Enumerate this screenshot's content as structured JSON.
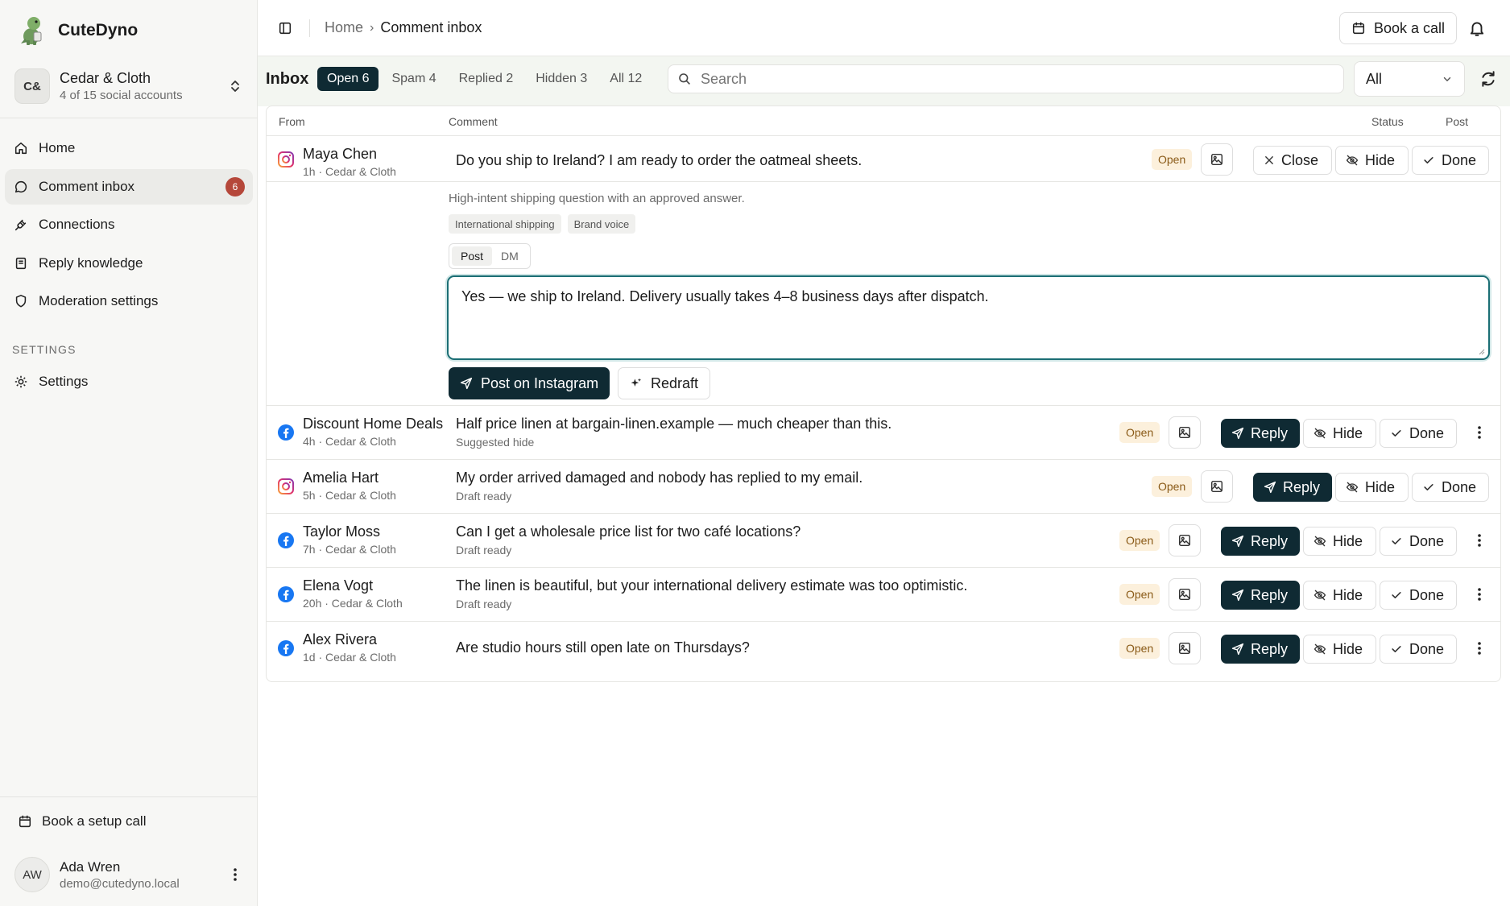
{
  "brand": {
    "name": "CuteDyno"
  },
  "account": {
    "initials": "C&",
    "name": "Cedar & Cloth",
    "sub": "4 of 15 social accounts"
  },
  "nav": [
    {
      "label": "Home"
    },
    {
      "label": "Comment inbox",
      "badge": "6"
    },
    {
      "label": "Connections"
    },
    {
      "label": "Reply knowledge"
    },
    {
      "label": "Moderation settings"
    }
  ],
  "settings_section": {
    "label": "SETTINGS",
    "item": "Settings"
  },
  "footer": {
    "setup_call": "Book a setup call",
    "user_initials": "AW",
    "user_name": "Ada Wren",
    "user_email": "demo@cutedyno.local"
  },
  "topbar": {
    "crumb_home": "Home",
    "crumb_current": "Comment inbox",
    "book_call": "Book a call"
  },
  "inbox": {
    "title": "Inbox",
    "tabs": [
      "Open 6",
      "Spam 4",
      "Replied 2",
      "Hidden 3",
      "All 12"
    ],
    "search_placeholder": "Search",
    "filter_value": "All"
  },
  "table": {
    "headers": {
      "from": "From",
      "comment": "Comment",
      "status": "Status",
      "post": "Post"
    },
    "expanded": {
      "name": "Maya Chen",
      "meta": "1h · Cedar & Cloth",
      "comment": "Do you ship to Ireland? I am ready to order the oatmeal sheets.",
      "status": "Open",
      "close": "Close",
      "hide": "Hide",
      "done": "Done",
      "reason": "High-intent shipping question with an approved answer.",
      "chips": [
        "International shipping",
        "Brand voice"
      ],
      "modes": [
        "Post",
        "DM"
      ],
      "draft": "Yes — we ship to Ireland. Delivery usually takes 4–8 business days after dispatch.",
      "post_button": "Post on Instagram",
      "redraft_button": "Redraft"
    },
    "rows": [
      {
        "platform": "facebook",
        "name": "Discount Home Deals",
        "meta": "4h · Cedar & Cloth",
        "comment": "Half price linen at bargain-linen.example — much cheaper than this.",
        "sub": "Suggested hide",
        "status": "Open",
        "reply": "Reply",
        "hide": "Hide",
        "done": "Done"
      },
      {
        "platform": "instagram",
        "name": "Amelia Hart",
        "meta": "5h · Cedar & Cloth",
        "comment": "My order arrived damaged and nobody has replied to my email.",
        "sub": "Draft ready",
        "status": "Open",
        "reply": "Reply",
        "hide": "Hide",
        "done": "Done"
      },
      {
        "platform": "facebook",
        "name": "Taylor Moss",
        "meta": "7h · Cedar & Cloth",
        "comment": "Can I get a wholesale price list for two café locations?",
        "sub": "Draft ready",
        "status": "Open",
        "reply": "Reply",
        "hide": "Hide",
        "done": "Done"
      },
      {
        "platform": "facebook",
        "name": "Elena Vogt",
        "meta": "20h · Cedar & Cloth",
        "comment": "The linen is beautiful, but your international delivery estimate was too optimistic.",
        "sub": "Draft ready",
        "status": "Open",
        "reply": "Reply",
        "hide": "Hide",
        "done": "Done"
      },
      {
        "platform": "facebook",
        "name": "Alex Rivera",
        "meta": "1d · Cedar & Cloth",
        "comment": "Are studio hours still open late on Thursdays?",
        "sub": "",
        "status": "Open",
        "reply": "Reply",
        "hide": "Hide",
        "done": "Done"
      }
    ]
  },
  "colors": {
    "primary": "#0f2a33",
    "badge_red": "#b5473a",
    "open_bg": "#fcf0dc",
    "open_text": "#8a5a17",
    "focus": "#1b6e74",
    "facebook": "#1877f2"
  }
}
